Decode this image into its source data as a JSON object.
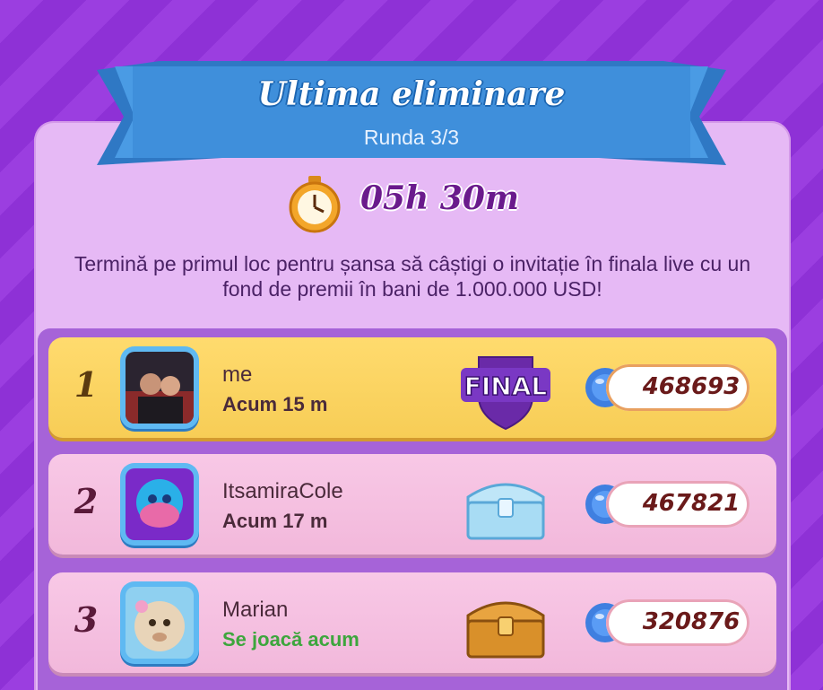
{
  "header": {
    "title": "Ultima eliminare",
    "round": "Runda 3/3"
  },
  "timer": {
    "icon": "stopwatch-icon",
    "remaining": "05h 30m"
  },
  "description": "Termină pe primul loc pentru șansa să câștigi o invitație în finala live cu un fond de premii în bani de 1.000.000 USD!",
  "leaderboard": [
    {
      "rank": "1",
      "name": "me",
      "status": "Acum 15 m",
      "reward": "FINAL",
      "score": "468693"
    },
    {
      "rank": "2",
      "name": "ItsamiraCole",
      "status": "Acum 17 m",
      "reward_icon": "silver-chest-icon",
      "score": "467821"
    },
    {
      "rank": "3",
      "name": "Marian",
      "status": "Se joacă acum",
      "reward_icon": "gold-chest-icon",
      "score": "320876"
    }
  ],
  "colors": {
    "background": "#9b3ee0",
    "panel": "#e6b9f5",
    "ribbon": "#3e8fdc",
    "highlight_row": "#ffd766",
    "row": "#f5bfe0",
    "playing_status": "#3da63d"
  }
}
